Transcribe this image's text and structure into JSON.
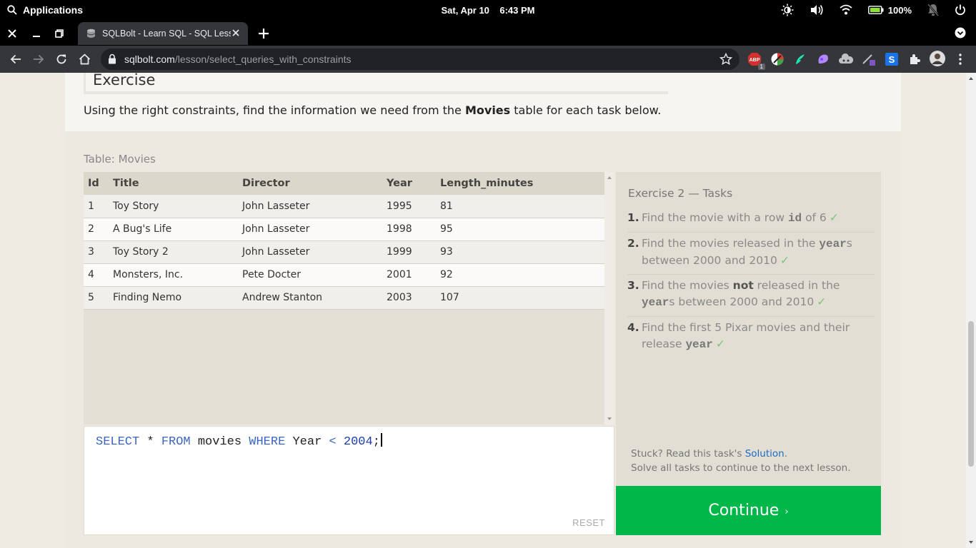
{
  "os": {
    "apps_label": "Applications",
    "clock": "Sat, Apr 10    6:43 PM",
    "battery": "100%"
  },
  "browser": {
    "tab_title": "SQLBolt - Learn SQL - SQL Lesson",
    "url_host": "sqlbolt.com",
    "url_path": "/lesson/select_queries_with_constraints",
    "abp_badge": "1"
  },
  "page": {
    "exercise_title": "Exercise",
    "intro_before": "Using the right constraints, find the information we need from the ",
    "intro_bold": "Movies",
    "intro_after": " table for each task below.",
    "table_label": "Table: Movies",
    "table": {
      "columns": [
        "Id",
        "Title",
        "Director",
        "Year",
        "Length_minutes"
      ],
      "rows": [
        [
          "1",
          "Toy Story",
          "John Lasseter",
          "1995",
          "81"
        ],
        [
          "2",
          "A Bug's Life",
          "John Lasseter",
          "1998",
          "95"
        ],
        [
          "3",
          "Toy Story 2",
          "John Lasseter",
          "1999",
          "93"
        ],
        [
          "4",
          "Monsters, Inc.",
          "Pete Docter",
          "2001",
          "92"
        ],
        [
          "5",
          "Finding Nemo",
          "Andrew Stanton",
          "2003",
          "107"
        ]
      ]
    },
    "query": {
      "kw_select": "SELECT",
      "star": " * ",
      "kw_from": "FROM",
      "table": " movies ",
      "kw_where": "WHERE",
      "col": " Year ",
      "op": "<",
      "space": " ",
      "num": "2004",
      "end": ";"
    },
    "reset_label": "RESET",
    "tasks": {
      "heading": "Exercise 2 — Tasks",
      "t1_num": "1.",
      "t1_a": "Find the movie with a row ",
      "t1_code": "id",
      "t1_b": " of 6",
      "t2_num": "2.",
      "t2_a": "Find the movies released in the ",
      "t2_code": "year",
      "t2_b": "s between 2000 and 2010",
      "t3_num": "3.",
      "t3_a": "Find the movies ",
      "t3_bold": "not",
      "t3_b": " released in the ",
      "t3_code": "year",
      "t3_c": "s between 2000 and 2010",
      "t4_num": "4.",
      "t4_a": "Find the first 5 Pixar movies and their release ",
      "t4_code": "year",
      "check": "✓"
    },
    "stuck_prefix": "Stuck? Read this task's ",
    "solution_link": "Solution",
    "stuck_suffix": ".",
    "stuck_line2": "Solve all tasks to continue to the next lesson.",
    "continue_label": "Continue",
    "continue_chevron": "›"
  },
  "colors": {
    "continue_bg": "#00b84a",
    "keyword": "#3b65c2",
    "link": "#1d6bc4",
    "check": "#7cc57a"
  }
}
